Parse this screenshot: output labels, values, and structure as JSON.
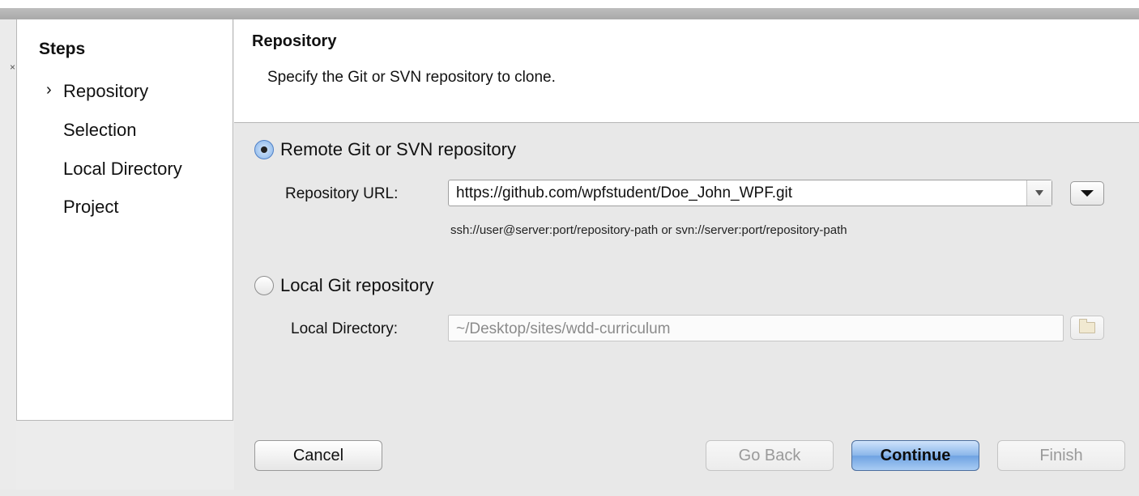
{
  "sidebar": {
    "title": "Steps",
    "current_marker": "›",
    "steps": [
      {
        "label": "Repository"
      },
      {
        "label": "Selection"
      },
      {
        "label": "Local Directory"
      },
      {
        "label": "Project"
      }
    ]
  },
  "header": {
    "title": "Repository",
    "description": "Specify the Git or SVN repository to clone."
  },
  "remote": {
    "radio_label": "Remote Git or SVN repository",
    "selected": true,
    "url_label": "Repository URL:",
    "url_value": "https://github.com/wpfstudent/Doe_John_WPF.git",
    "hint": "ssh://user@server:port/repository-path or svn://server:port/repository-path"
  },
  "local": {
    "radio_label": "Local Git repository",
    "selected": false,
    "dir_label": "Local Directory:",
    "dir_value": "~/Desktop/sites/wdd-curriculum"
  },
  "buttons": {
    "cancel": "Cancel",
    "go_back": "Go Back",
    "continue": "Continue",
    "finish": "Finish"
  },
  "colors": {
    "primary_button": "#8ab6ea",
    "selected_radio": "#9ec3ee"
  }
}
